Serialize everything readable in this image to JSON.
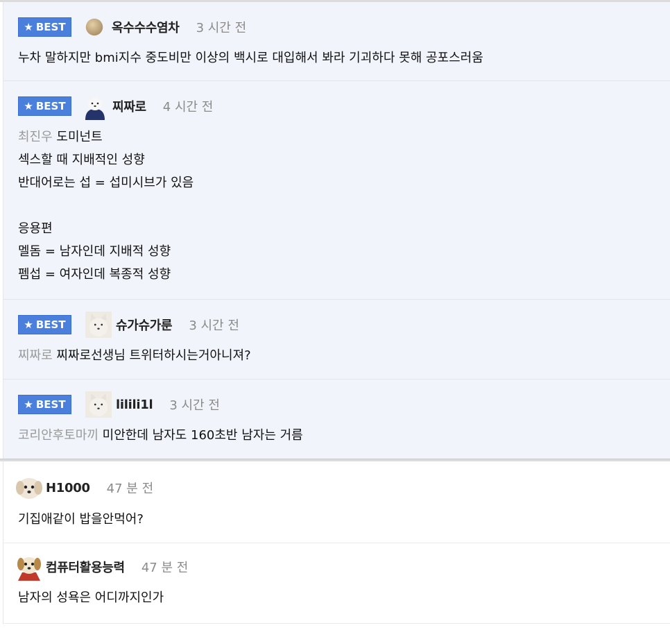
{
  "best_label": "BEST",
  "comments": [
    {
      "nick": "옥수수수염차",
      "time": "3 시간 전",
      "reply_to": "",
      "lines": [
        "누차 말하지만 bmi지수 중도비만 이상의 백시로 대입해서 봐라 기괴하다 못해 공포스러움"
      ]
    },
    {
      "nick": "찌짜로",
      "time": "4 시간 전",
      "reply_to": "최진우",
      "lines": [
        "도미넌트",
        "섹스할 때 지배적인 성향",
        "반대어로는 섭 = 섭미시브가 있음",
        "",
        "응용편",
        "멜돔 = 남자인데 지배적 성향",
        "펨섭 = 여자인데 복종적 성향"
      ]
    },
    {
      "nick": "슈가슈가룬",
      "time": "3 시간 전",
      "reply_to": "찌짜로",
      "lines": [
        "찌짜로선생님 트위터하시는거아니져?"
      ]
    },
    {
      "nick": "lilili1l",
      "time": "3 시간 전",
      "reply_to": "코리안후토마끼",
      "lines": [
        "미안한데 남자도 160초반 남자는 거름"
      ]
    },
    {
      "nick": "H1000",
      "time": "47 분 전",
      "reply_to": "",
      "lines": [
        "기집애같이 밥을안먹어?"
      ]
    },
    {
      "nick": "컴퓨터활용능력",
      "time": "47 분 전",
      "reply_to": "",
      "lines": [
        "남자의 성욕은 어디까지인가"
      ]
    }
  ]
}
